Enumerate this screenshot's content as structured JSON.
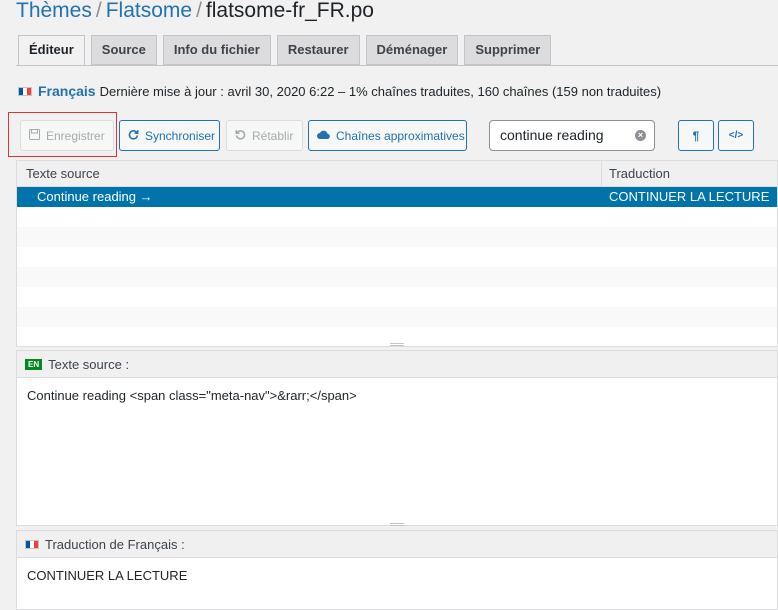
{
  "breadcrumb": {
    "themes": "Thèmes",
    "sep": "/",
    "theme": "Flatsome",
    "file": "flatsome-fr_FR.po"
  },
  "tabs": [
    {
      "label": "Éditeur"
    },
    {
      "label": "Source"
    },
    {
      "label": "Info du fichier"
    },
    {
      "label": "Restaurer"
    },
    {
      "label": "Déménager"
    },
    {
      "label": "Supprimer"
    }
  ],
  "status": {
    "language": "Français",
    "info": "Dernière mise à jour : avril 30, 2020 6:22 – 1% chaînes traduites, 160 chaînes (159 non traduites)"
  },
  "toolbar": {
    "save": "Enregistrer",
    "sync": "Synchroniser",
    "revert": "Rétablir",
    "fuzzy": "Chaînes approximatives",
    "search_value": "continue reading",
    "clear_icon": "×",
    "pilcrow": "¶",
    "code": "</>"
  },
  "grid": {
    "col_source": "Texte source",
    "col_translation": "Traduction",
    "rows": [
      {
        "source": "Continue reading →",
        "translation": "CONTINUER LA LECTURE"
      }
    ]
  },
  "source_pane": {
    "badge": "EN",
    "title": "Texte source :",
    "text": "Continue reading <span class=\"meta-nav\">&rarr;</span>"
  },
  "translation_pane": {
    "title": "Traduction de Français :",
    "text": "CONTINUER LA LECTURE"
  },
  "colors": {
    "accent": "#2271b1",
    "selected_row": "#0073aa",
    "highlight_box": "#d63638"
  }
}
